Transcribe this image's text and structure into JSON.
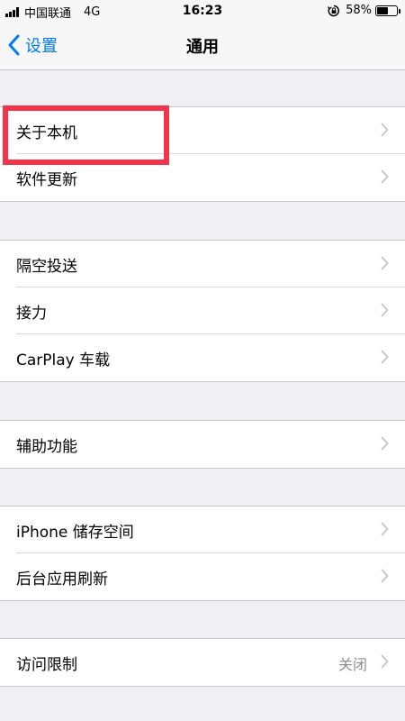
{
  "status_bar": {
    "carrier": "中国联通",
    "network": "4G",
    "time": "16:23",
    "battery_percent": "58%",
    "battery_level": 0.58
  },
  "nav": {
    "back_label": "设置",
    "title": "通用"
  },
  "groups": [
    {
      "items": [
        {
          "label": "关于本机"
        },
        {
          "label": "软件更新"
        }
      ]
    },
    {
      "items": [
        {
          "label": "隔空投送"
        },
        {
          "label": "接力"
        },
        {
          "label": "CarPlay 车载"
        }
      ]
    },
    {
      "items": [
        {
          "label": "辅助功能"
        }
      ]
    },
    {
      "items": [
        {
          "label": "iPhone 储存空间"
        },
        {
          "label": "后台应用刷新"
        }
      ]
    },
    {
      "items": [
        {
          "label": "访问限制",
          "value": "关闭"
        }
      ]
    }
  ],
  "colors": {
    "accent": "#007aff",
    "highlight": "#f2354b",
    "background": "#efeff4"
  },
  "icons": {
    "back": "chevron-left-icon",
    "disclosure": "chevron-right-icon"
  }
}
